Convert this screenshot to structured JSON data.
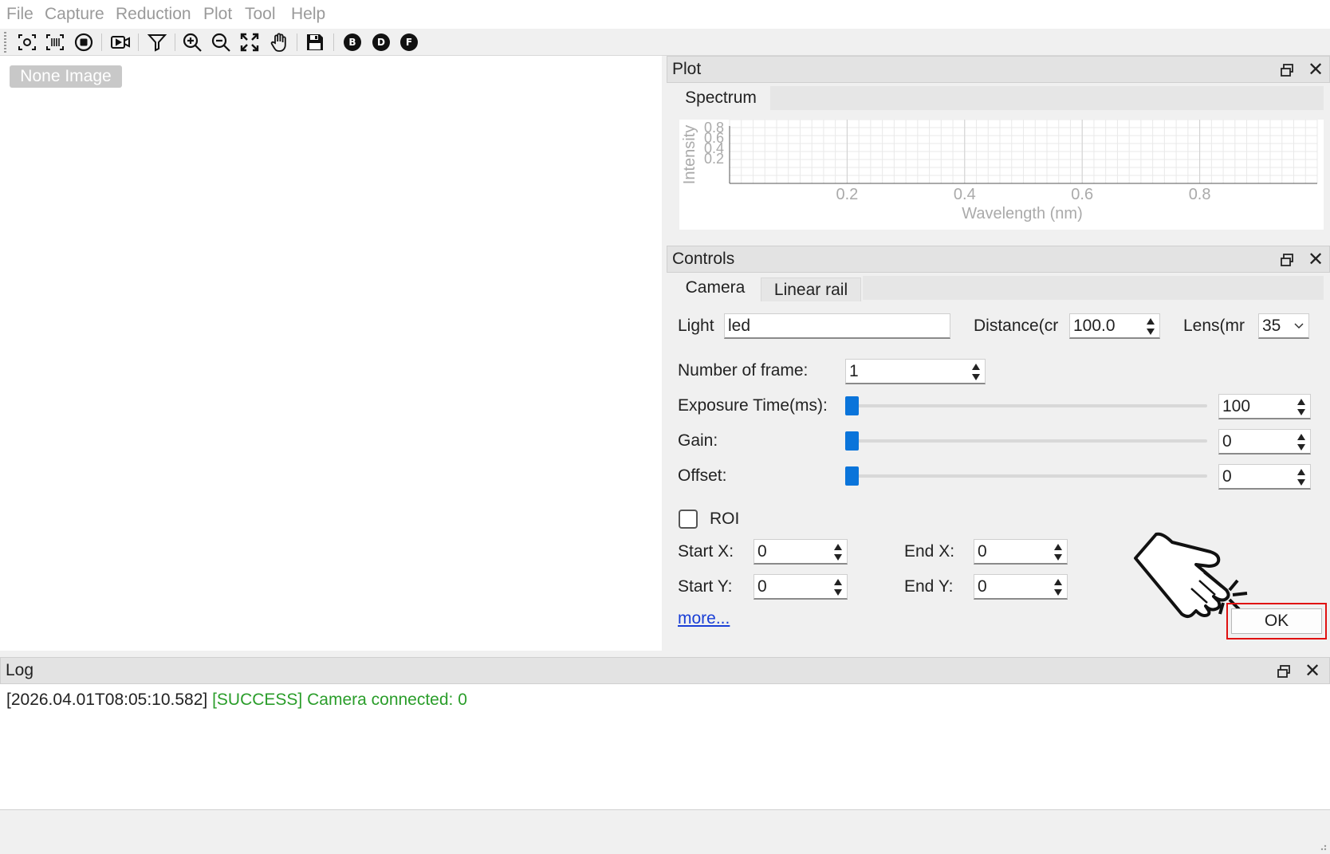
{
  "menu": {
    "file": "File",
    "capture": "Capture",
    "reduction": "Reduction",
    "plot": "Plot",
    "tool": "Tool",
    "help": "Help"
  },
  "toolbar": {
    "icons": [
      "focus-icon",
      "barcode-scan-icon",
      "stop-icon",
      "video-record-icon",
      "filter-icon",
      "zoom-in-icon",
      "zoom-out-icon",
      "fit-screen-icon",
      "pan-hand-icon",
      "save-icon",
      "b-circle-icon",
      "d-circle-icon",
      "f-circle-icon"
    ],
    "b_label": "B",
    "d_label": "D",
    "f_label": "F"
  },
  "image_view": {
    "badge": "None Image"
  },
  "plot_dock": {
    "title": "Plot",
    "tab": "Spectrum",
    "chart_data": {
      "type": "line",
      "xlabel": "Wavelength (nm)",
      "ylabel": "Intensity",
      "x_ticks": [
        "0.2",
        "0.4",
        "0.6",
        "0.8"
      ],
      "y_ticks": [
        "0.8",
        "0.6",
        "0.4",
        "0.2"
      ],
      "series": [],
      "grid": true
    }
  },
  "controls_dock": {
    "title": "Controls",
    "tabs": {
      "camera": "Camera",
      "linear_rail": "Linear rail"
    },
    "light_label": "Light",
    "light_value": "led",
    "distance_label": "Distance(cr",
    "distance_value": "100.0",
    "lens_label": "Lens(mr",
    "lens_value": "35",
    "frames_label": "Number of frame:",
    "frames_value": "1",
    "exposure_label": "Exposure Time(ms):",
    "exposure_value": "100",
    "exposure_slider_fraction": 0.0,
    "gain_label": "Gain:",
    "gain_value": "0",
    "gain_slider_fraction": 0.0,
    "offset_label": "Offset:",
    "offset_value": "0",
    "offset_slider_fraction": 0.0,
    "roi_label": "ROI",
    "roi_checked": false,
    "start_x_label": "Start X:",
    "start_x_value": "0",
    "end_x_label": "End X:",
    "end_x_value": "0",
    "start_y_label": "Start Y:",
    "start_y_value": "0",
    "end_y_label": "End Y:",
    "end_y_value": "0",
    "more_link": "more...",
    "ok_button": "OK"
  },
  "log_dock": {
    "title": "Log",
    "entries": [
      {
        "timestamp": "[2026.04.01T08:05:10.582]",
        "status": "[SUCCESS]",
        "message": "Camera connected: 0",
        "status_color": "#2a9d2a"
      }
    ]
  },
  "colors": {
    "accent": "#0a74da",
    "highlight": "#e01010",
    "link": "#1a3fd6",
    "success": "#2a9d2a"
  }
}
